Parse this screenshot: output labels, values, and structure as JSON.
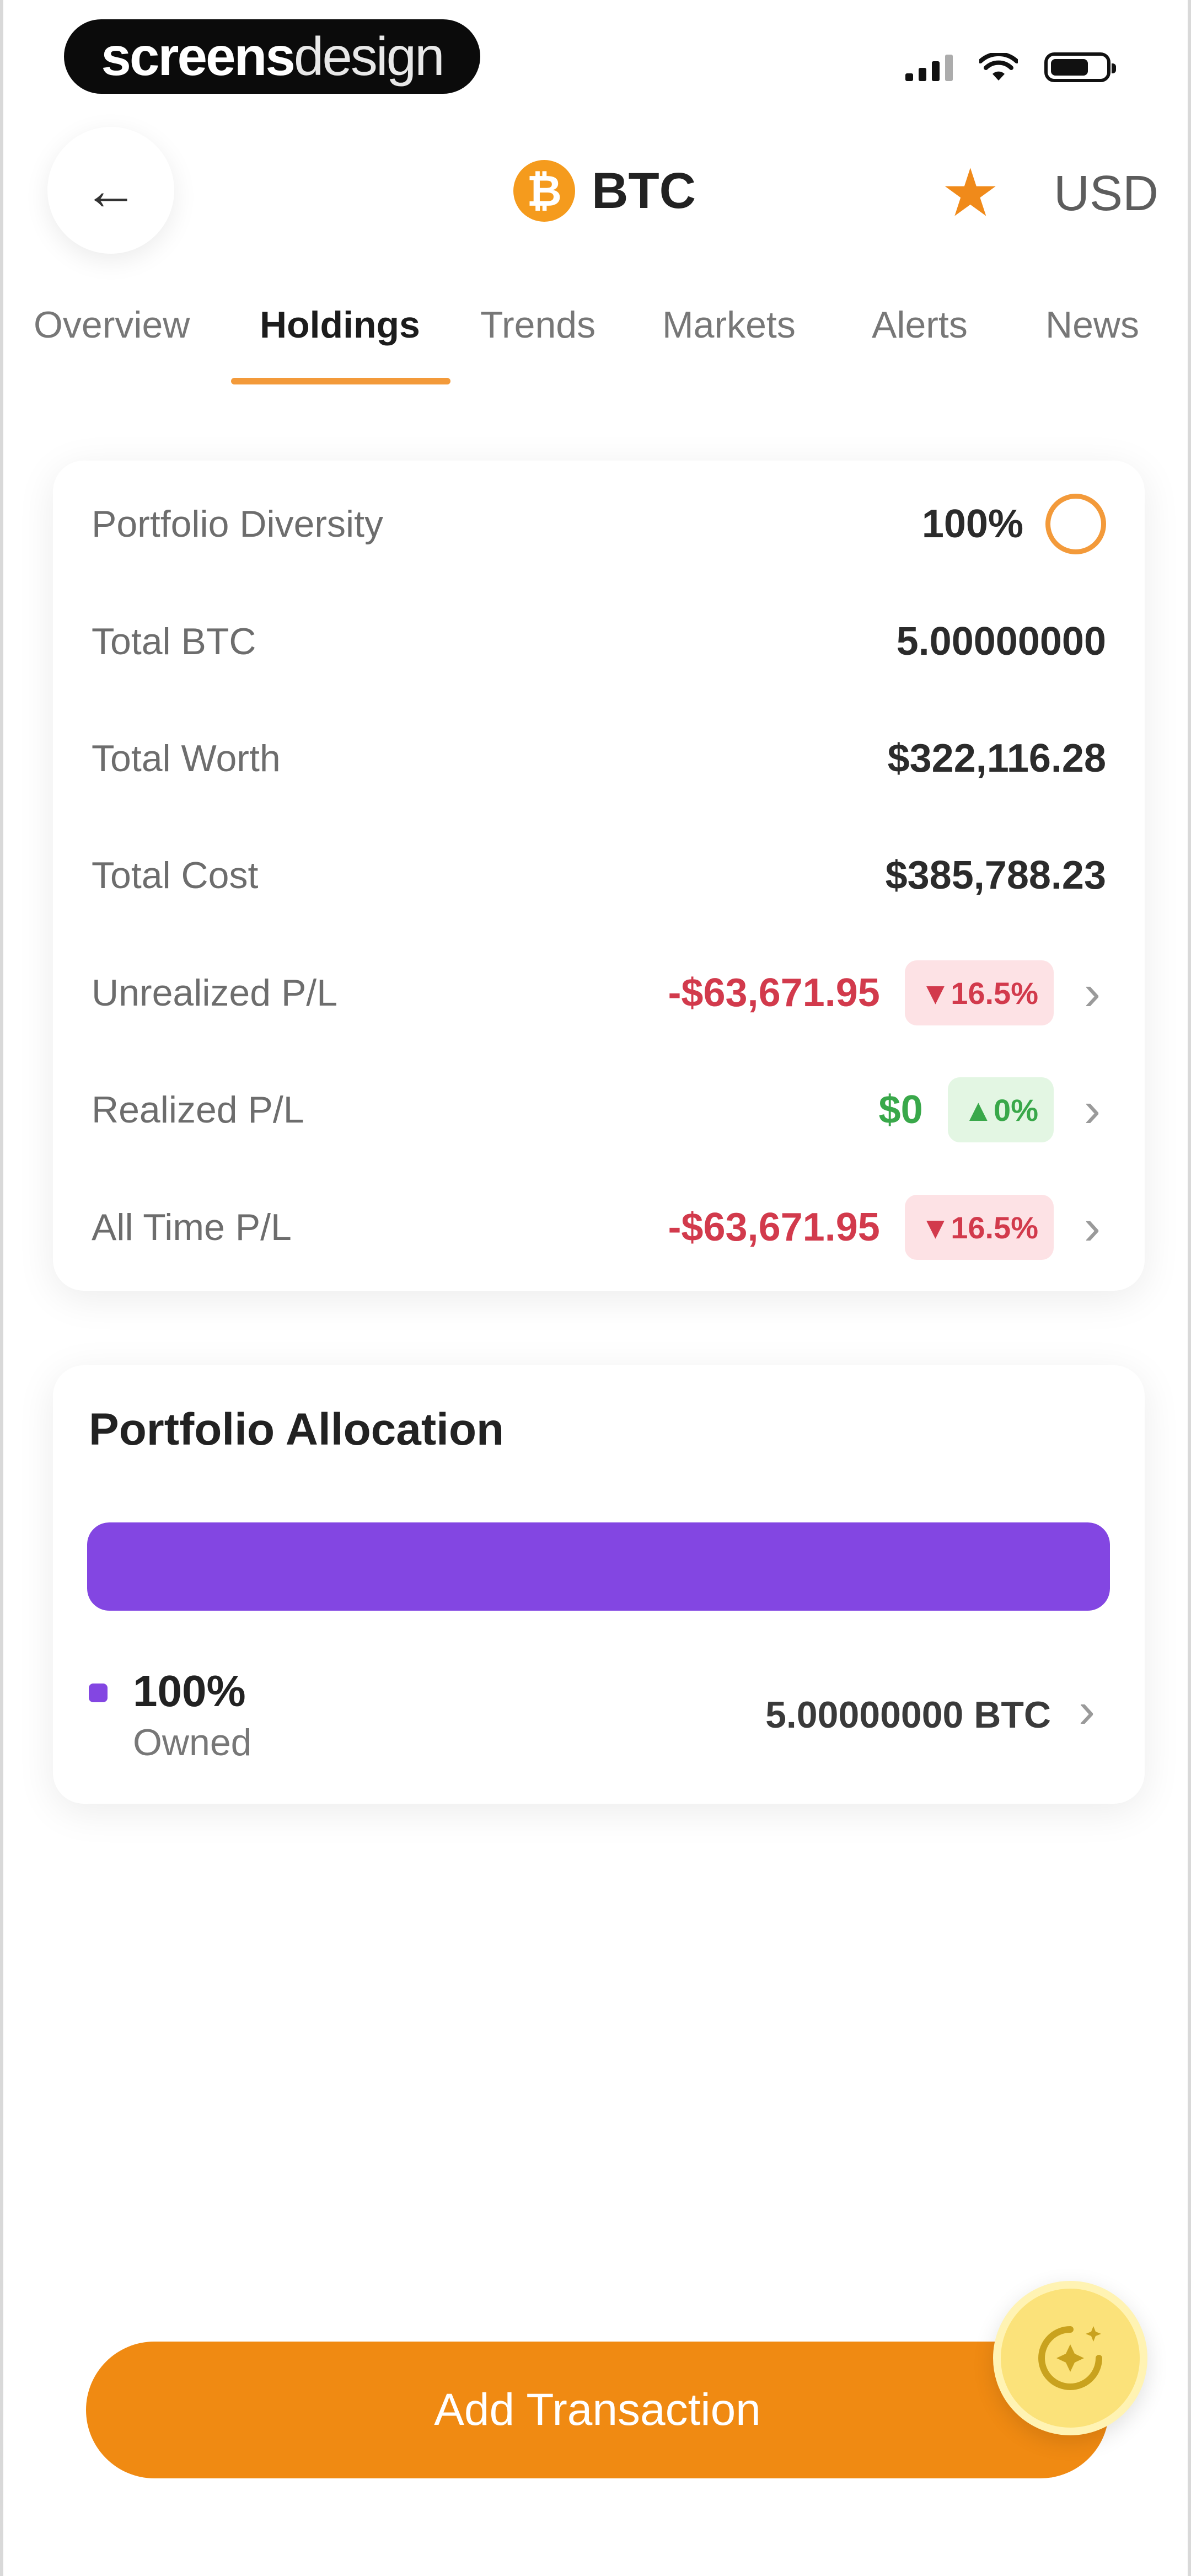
{
  "status_bar": {
    "brand_bold": "screens",
    "brand_light": "design"
  },
  "header": {
    "back_icon": "arrow-left-icon",
    "coin_symbol": "BTC",
    "coin_logo_glyph": "₿",
    "favorite_icon": "star-icon",
    "currency": "USD"
  },
  "tabs": [
    {
      "label": "Overview",
      "active": false
    },
    {
      "label": "Holdings",
      "active": true
    },
    {
      "label": "Trends",
      "active": false
    },
    {
      "label": "Markets",
      "active": false
    },
    {
      "label": "Alerts",
      "active": false
    },
    {
      "label": "News",
      "active": false
    }
  ],
  "holdings": {
    "diversity": {
      "label": "Portfolio Diversity",
      "value": "100%"
    },
    "total_btc": {
      "label": "Total BTC",
      "value": "5.00000000"
    },
    "total_worth": {
      "label": "Total Worth",
      "value": "$322,116.28"
    },
    "total_cost": {
      "label": "Total Cost",
      "value": "$385,788.23"
    },
    "unrealized": {
      "label": "Unrealized P/L",
      "value": "-$63,671.95",
      "badge": "▼16.5%"
    },
    "realized": {
      "label": "Realized P/L",
      "value": "$0",
      "badge": "▲0%"
    },
    "all_time": {
      "label": "All Time P/L",
      "value": "-$63,671.95",
      "badge": "▼16.5%"
    }
  },
  "allocation": {
    "title": "Portfolio Allocation",
    "fill_fraction": 1.0,
    "bar_color": "#8346e2",
    "legend": {
      "percent": "100%",
      "label": "Owned",
      "amount": "5.00000000 BTC"
    }
  },
  "actions": {
    "add_transaction": "Add Transaction",
    "ai_icon": "sparkle-assistant-icon"
  },
  "colors": {
    "accent": "#f08a12",
    "negative": "#d23a4c",
    "positive": "#39a84a",
    "purple": "#8346e2"
  }
}
